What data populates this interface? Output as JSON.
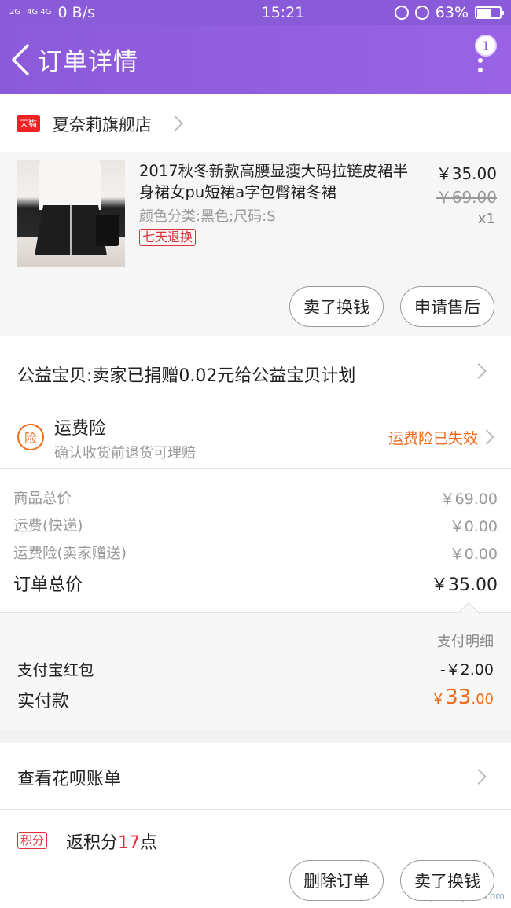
{
  "status_bar": {
    "signal_1": "2G",
    "signal_2": "4G 4G",
    "net_speed": "0 B/s",
    "time": "15:21",
    "battery": "63%",
    "battery_level": 0.63
  },
  "nav": {
    "title": "订单详情",
    "badge_count": "1"
  },
  "shop": {
    "badge": "天猫",
    "name": "夏奈莉旗舰店"
  },
  "item": {
    "title": "2017秋冬新款高腰显瘦大码拉链皮裙半身裙女pu短裙a字包臀裙冬裙",
    "sku": "颜色分类:黑色;尺码:S",
    "tag": "七天退换",
    "price": "￥35.00",
    "original_price": "￥69.00",
    "quantity": "x1",
    "btn_sell": "卖了换钱",
    "btn_aftersale": "申请售后"
  },
  "charity": {
    "text": "公益宝贝:卖家已捐赠0.02元给公益宝贝计划"
  },
  "insurance": {
    "icon_char": "险",
    "title": "运费险",
    "subtitle": "确认收货前退货可理赔",
    "status": "运费险已失效"
  },
  "summary": {
    "rows": [
      {
        "label": "商品总价",
        "value": "￥69.00"
      },
      {
        "label": "运费(快递)",
        "value": "￥0.00"
      },
      {
        "label": "运费险(卖家赠送)",
        "value": "￥0.00"
      }
    ],
    "total_label": "订单总价",
    "total_value": "￥35.00"
  },
  "payment": {
    "detail_label": "支付明细",
    "redpacket_label": "支付宝红包",
    "redpacket_value": "-￥2.00",
    "paid_label": "实付款",
    "paid_currency": "￥",
    "paid_int": "33",
    "paid_dec": ".00"
  },
  "bill": {
    "text": "查看花呗账单"
  },
  "points": {
    "tag": "积分",
    "prefix": "返积分",
    "count": "17",
    "suffix": "点"
  },
  "bottom": {
    "btn_delete": "删除订单",
    "btn_sell": "卖了换钱"
  },
  "watermark": {
    "text": "JiChengXin.com"
  },
  "colors": {
    "nav": "#8b5ad9",
    "accent_orange": "#f06a1a",
    "accent_red": "#e0303a"
  }
}
